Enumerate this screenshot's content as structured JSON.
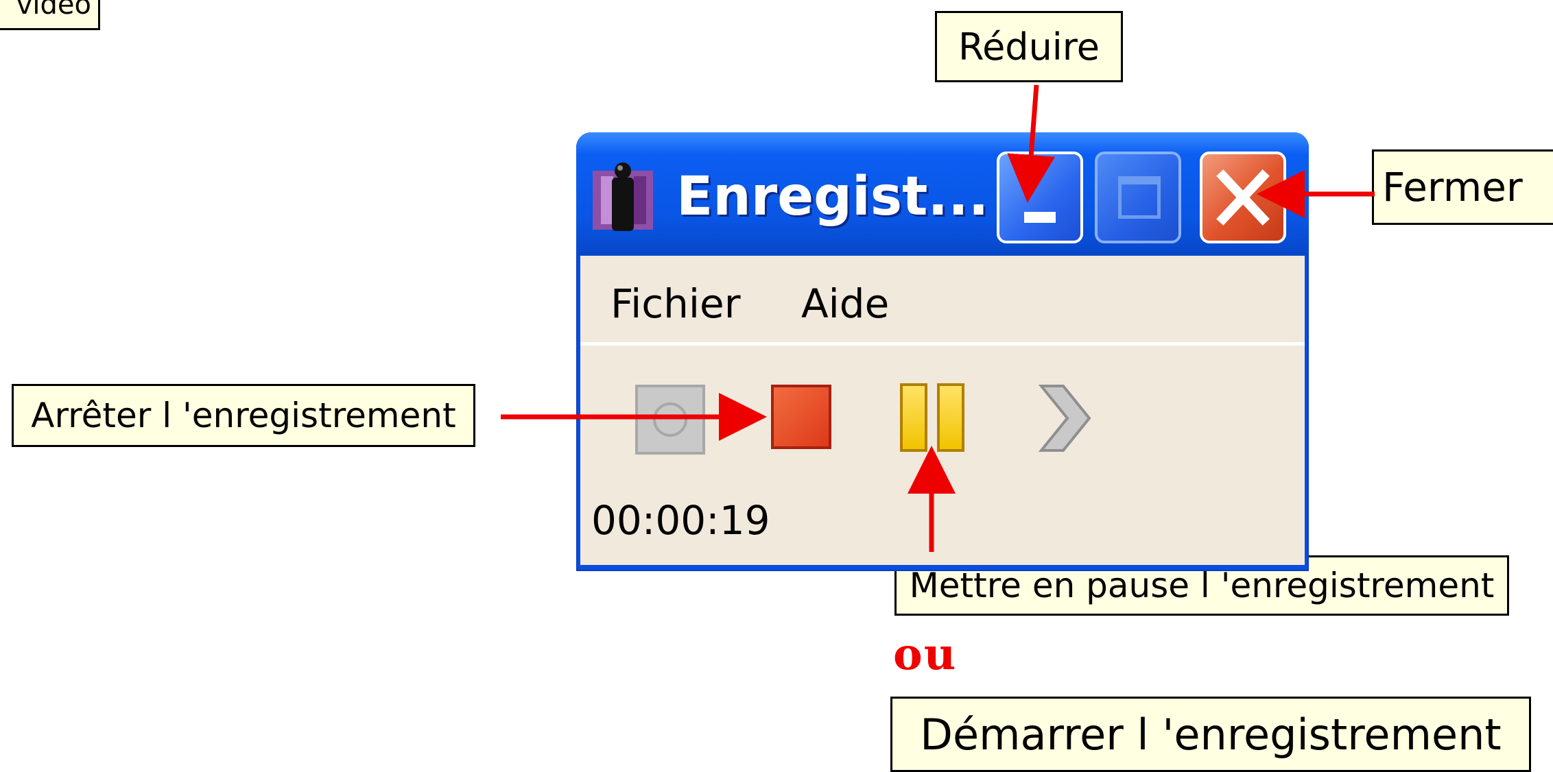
{
  "callouts": {
    "video": "vidéo",
    "reduire": "Réduire",
    "fermer": "Fermer",
    "arreter": "Arrêter l 'enregistrement",
    "pause": "Mettre en pause l 'enregistrement",
    "ou": "ou",
    "demarrer": "Démarrer l 'enregistrement"
  },
  "window": {
    "title": "Enregist...",
    "menu": [
      "Fichier",
      "Aide"
    ],
    "timer": "00:00:19",
    "caption_buttons": [
      "minimize",
      "maximize",
      "close"
    ]
  },
  "toolbar": {
    "icons": [
      "record-icon",
      "stop-icon",
      "pause-icon",
      "next-icon"
    ]
  },
  "colors": {
    "titlebar": "#0a55e4",
    "client_bg": "#f1e9dc",
    "callout_bg": "#ffffe1",
    "arrow": "#ee0000",
    "close_button": "#e0532c",
    "stop": "#dd3a18",
    "pause": "#f2c300"
  }
}
